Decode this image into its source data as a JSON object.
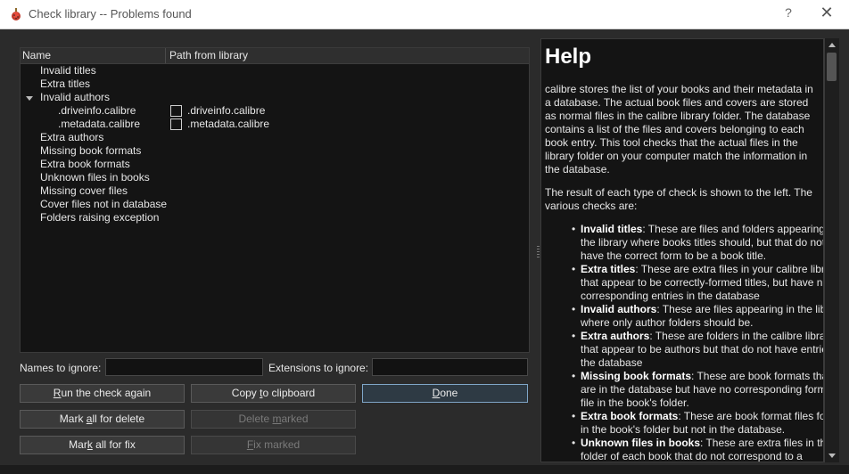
{
  "window": {
    "title": "Check library -- Problems found",
    "help_glyph": "?",
    "close_glyph": "✕"
  },
  "tree": {
    "headers": [
      "Name",
      "Path from library"
    ],
    "rows": [
      "Invalid titles",
      "Extra titles",
      "Invalid authors",
      ".driveinfo.calibre",
      ".metadata.calibre",
      "Extra authors",
      "Missing book formats",
      "Extra book formats",
      "Unknown files in books",
      "Missing cover files",
      "Cover files not in database",
      "Folders raising exception"
    ],
    "paths": [
      ".driveinfo.calibre",
      ".metadata.calibre"
    ]
  },
  "filters": {
    "names_label": "Names to ignore:",
    "names_value": "",
    "extensions_label": "Extensions to ignore:",
    "extensions_value": ""
  },
  "buttons": {
    "run_pre": "",
    "run_key": "R",
    "run_post": "un the check again",
    "copy_pre": "Copy ",
    "copy_key": "t",
    "copy_post": "o clipboard",
    "done_pre": "",
    "done_key": "D",
    "done_post": "one",
    "mark_delete_pre": "Mark ",
    "mark_delete_key": "a",
    "mark_delete_post": "ll for delete",
    "delete_marked_pre": "Delete ",
    "delete_marked_key": "m",
    "delete_marked_post": "arked",
    "mark_fix_pre": "Mar",
    "mark_fix_key": "k",
    "mark_fix_post": " all for fix",
    "fix_marked_pre": "",
    "fix_marked_key": "F",
    "fix_marked_post": "ix marked"
  },
  "help": {
    "heading": "Help",
    "para1": "calibre stores the list of your books and their metadata in a database. The actual book files and covers are stored as normal files in the calibre library folder. The database contains a list of the files and covers belonging to each book entry. This tool checks that the actual files in the library folder on your computer match the information in the database.",
    "para2": "The result of each type of check is shown to the left. The various checks are:",
    "items": [
      {
        "term": "Invalid titles",
        "text": ": These are files and folders appearing in the library where books titles should, but that do not have the correct form to be a book title."
      },
      {
        "term": "Extra titles",
        "text": ": These are extra files in your calibre library that appear to be correctly-formed titles, but have no corresponding entries in the database"
      },
      {
        "term": "Invalid authors",
        "text": ": These are files appearing in the library where only author folders should be."
      },
      {
        "term": "Extra authors",
        "text": ": These are folders in the calibre library that appear to be authors but that do not have entries in the database"
      },
      {
        "term": "Missing book formats",
        "text": ": These are book formats that are in the database but have no corresponding format file in the book's folder."
      },
      {
        "term": "Extra book formats",
        "text": ": These are book format files found in the book's folder but not in the database."
      },
      {
        "term": "Unknown files in books",
        "text": ": These are extra files in the folder of each book that do not correspond to a"
      }
    ]
  },
  "colors": {
    "background": "#2b2b2b",
    "panel": "#141414",
    "accent_border": "#7fa6c8"
  }
}
